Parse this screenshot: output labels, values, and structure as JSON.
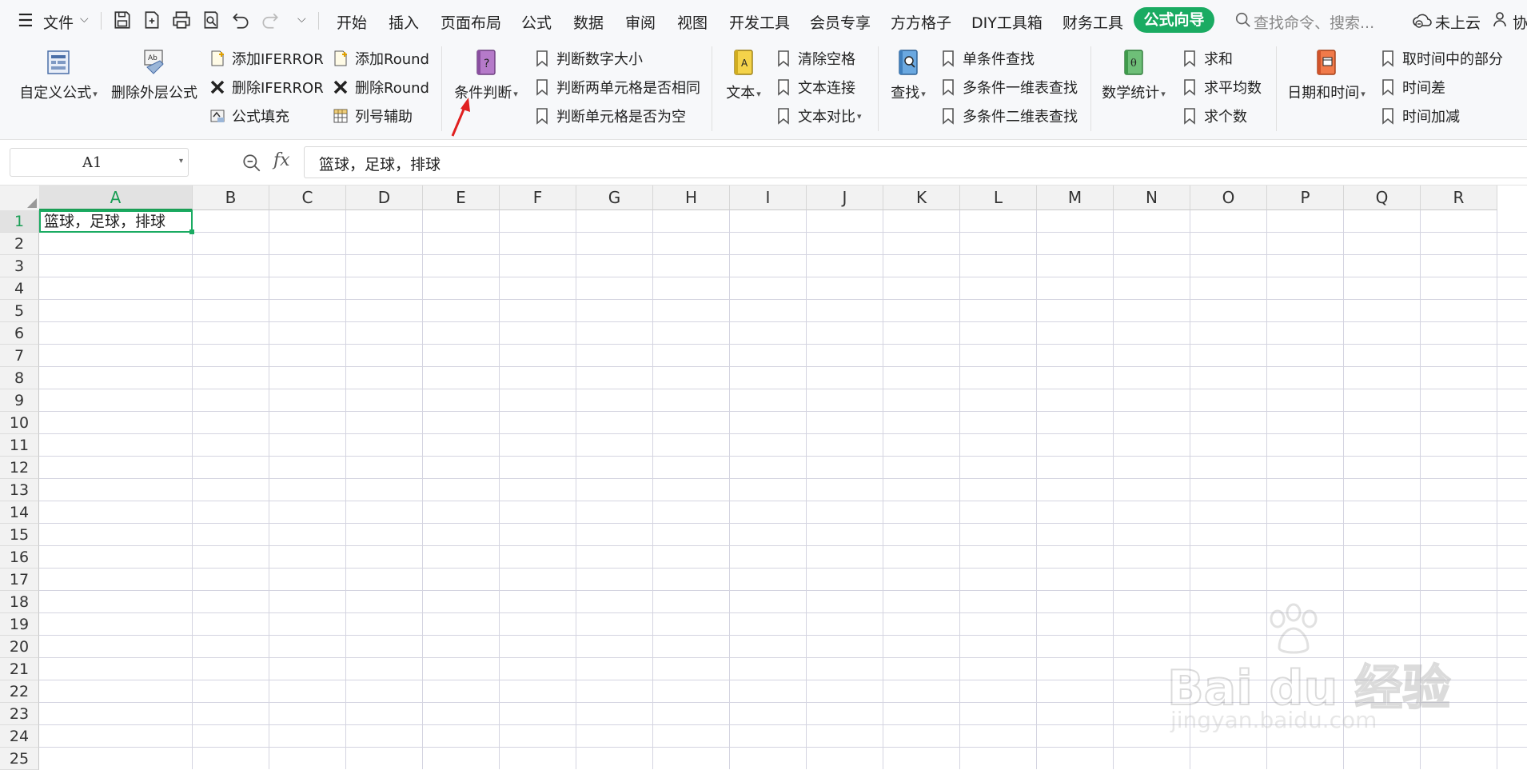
{
  "topbar": {
    "file_menu": "文件",
    "tabs": [
      "开始",
      "插入",
      "页面布局",
      "公式",
      "数据",
      "审阅",
      "视图",
      "开发工具",
      "会员专享",
      "方方格子",
      "DIY工具箱",
      "财务工具"
    ],
    "active_tab": "公式向导",
    "search_placeholder": "查找命令、搜索...",
    "cloud_status": "未上云",
    "collab_partial": "协"
  },
  "ribbon": {
    "custom_formula": "自定义公式",
    "remove_outer": "删除外层公式",
    "add_iferror": "添加IFERROR",
    "del_iferror": "删除IFERROR",
    "formula_fill": "公式填充",
    "add_round": "添加Round",
    "del_round": "删除Round",
    "col_helper": "列号辅助",
    "condition": "条件判断",
    "judge_size": "判断数字大小",
    "judge_same": "判断两单元格是否相同",
    "judge_empty": "判断单元格是否为空",
    "text": "文本",
    "clear_space": "清除空格",
    "text_join": "文本连接",
    "text_compare": "文本对比",
    "lookup": "查找",
    "single_lookup": "单条件查找",
    "multi_1d": "多条件一维表查找",
    "multi_2d": "多条件二维表查找",
    "math_stats": "数学统计",
    "sum": "求和",
    "average": "求平均数",
    "count": "求个数",
    "datetime": "日期和时间",
    "time_part": "取时间中的部分",
    "time_diff": "时间差",
    "time_add": "时间加减"
  },
  "formula_bar": {
    "name_box": "A1",
    "fx_label": "fx",
    "content": "篮球，足球，排球"
  },
  "sheet": {
    "columns": [
      "A",
      "B",
      "C",
      "D",
      "E",
      "F",
      "G",
      "H",
      "I",
      "J",
      "K",
      "L",
      "M",
      "N",
      "O",
      "P",
      "Q",
      "R"
    ],
    "rows": [
      "1",
      "2",
      "3",
      "4",
      "5",
      "6",
      "7",
      "8",
      "9",
      "10",
      "11",
      "12",
      "13",
      "14",
      "15",
      "16",
      "17",
      "18",
      "19",
      "20",
      "21",
      "22",
      "23",
      "24",
      "25"
    ],
    "selected_col": "A",
    "selected_row": "1",
    "cell_a1": "篮球，足球，排球"
  },
  "watermark": {
    "brand": "Bai du 经验",
    "url": "jingyan.baidu.com"
  },
  "colors": {
    "accent": "#1aab62",
    "annotation_arrow": "#e02020"
  }
}
